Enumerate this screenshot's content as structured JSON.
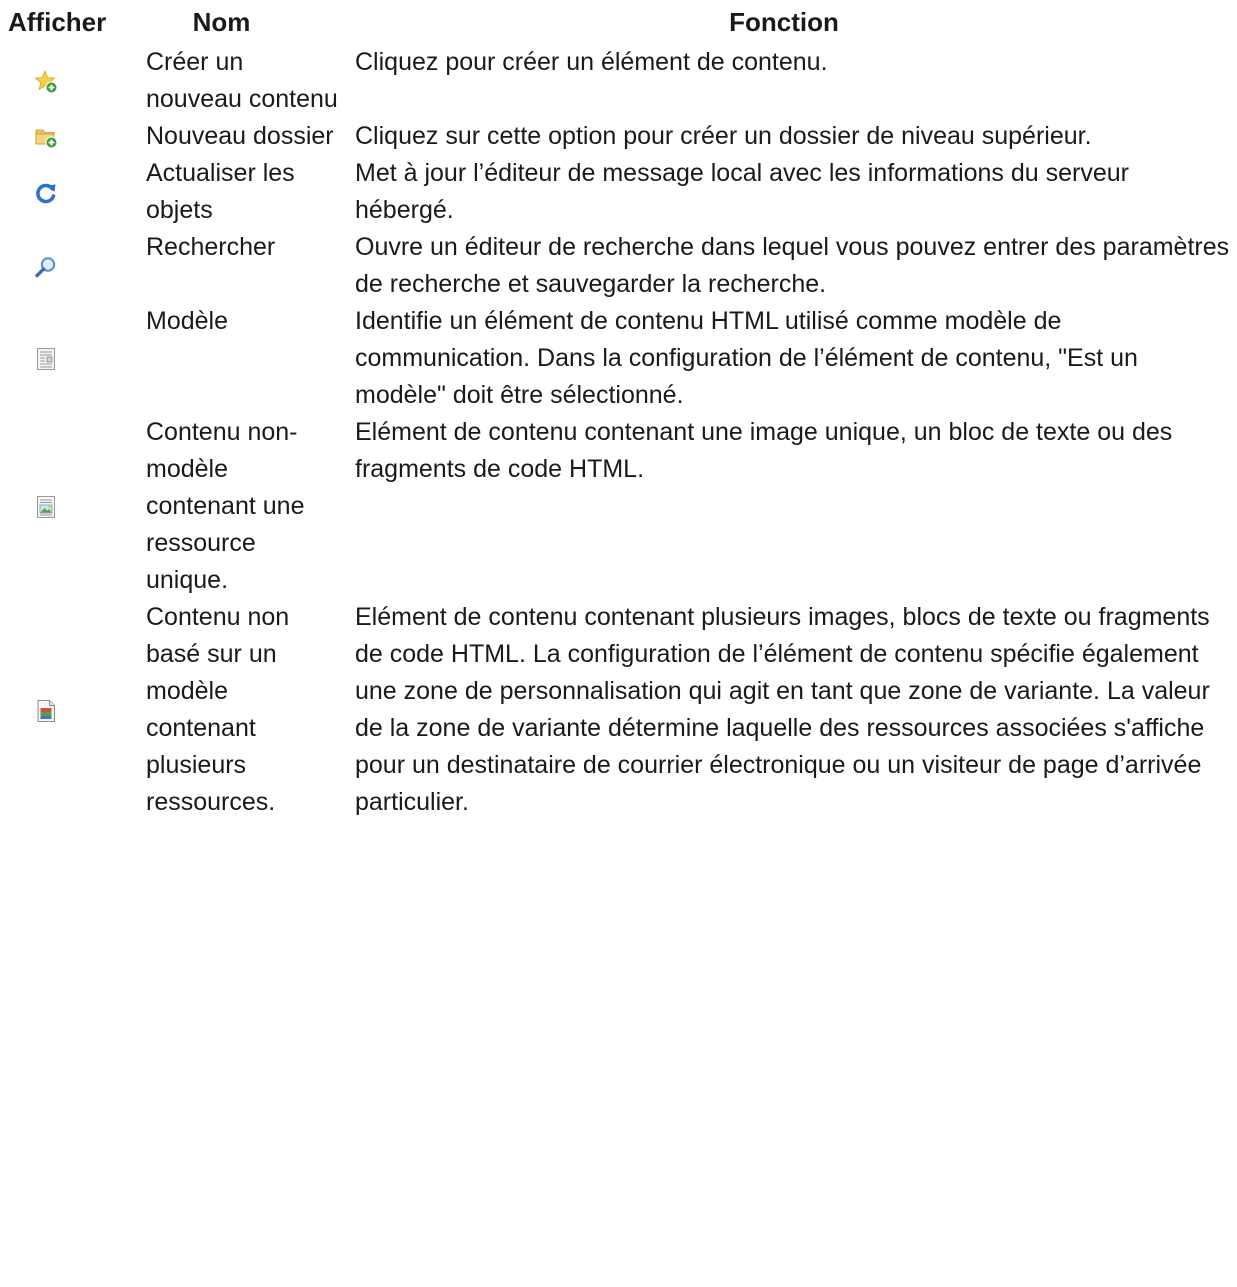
{
  "table": {
    "headers": {
      "icon": "Afficher",
      "name": "Nom",
      "function": "Fonction"
    },
    "rows": [
      {
        "icon": "star-add-icon",
        "name": "Créer un nouveau contenu",
        "function": "Cliquez pour créer un élément de contenu."
      },
      {
        "icon": "folder-add-icon",
        "name": "Nouveau dossier",
        "function": "Cliquez sur cette option pour créer un dossier de niveau supérieur."
      },
      {
        "icon": "refresh-icon",
        "name": "Actualiser les objets",
        "function": "Met à jour l’éditeur de message local avec les informations du serveur hébergé."
      },
      {
        "icon": "search-icon",
        "name": "Rechercher",
        "function": "Ouvre un éditeur de recherche dans lequel vous pouvez entrer des paramètres de recherche et sauvegarder la recherche."
      },
      {
        "icon": "template-icon",
        "name": "Modèle",
        "function": "Identifie un élément de contenu HTML utilisé comme modèle de communication. Dans la configuration de l’élément de contenu, \"Est un modèle\" doit être sélectionné."
      },
      {
        "icon": "single-asset-content-icon",
        "name": "Contenu non-modèle contenant une ressource unique.",
        "function": "Elément de contenu contenant une image unique, un bloc de texte ou des fragments de code HTML."
      },
      {
        "icon": "multi-asset-content-icon",
        "name": "Contenu non basé sur un modèle contenant plusieurs ressources.",
        "function": "Elément de contenu contenant plusieurs images, blocs de texte ou fragments de code HTML. La configuration de l’élément de contenu spécifie également une zone de personnalisation qui agit en tant que zone de variante. La valeur de la zone de variante détermine laquelle des ressources associées s'affiche pour un destinataire de courrier électronique ou un visiteur de page d’arrivée particulier."
      }
    ]
  }
}
